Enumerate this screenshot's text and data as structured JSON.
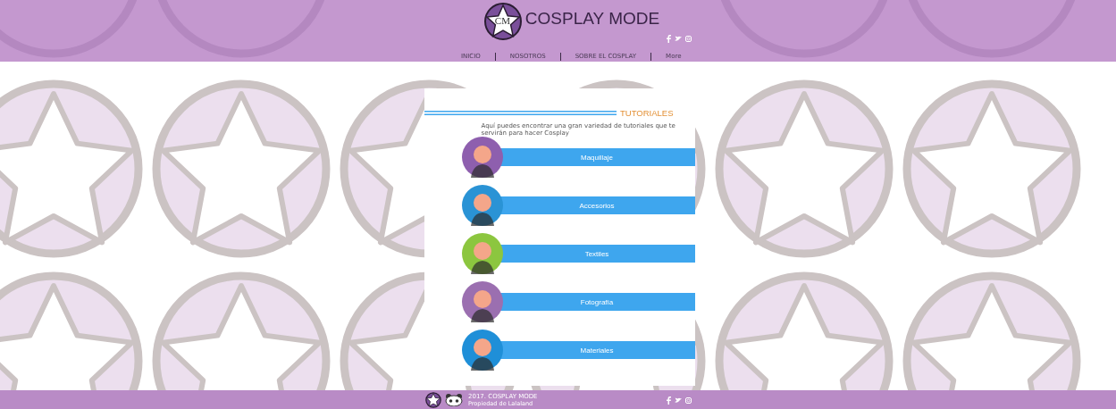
{
  "header": {
    "brand": "COSPLAY MODE",
    "logo_letters": "CM",
    "nav": [
      {
        "label": "INICIO"
      },
      {
        "label": "NOSOTROS"
      },
      {
        "label": "SOBRE EL COSPLAY"
      },
      {
        "label": "More"
      }
    ]
  },
  "section": {
    "title": "TUTORIALES",
    "description": "Aquí puedes encontrar una gran variedad de tutoriales que te servirán para hacer Cosplay",
    "tutorials": [
      {
        "label": "Maquillaje",
        "color": "#8e5fae"
      },
      {
        "label": "Accesorios",
        "color": "#2a93d5"
      },
      {
        "label": "Textiles",
        "color": "#8cc63f"
      },
      {
        "label": "Fotografía",
        "color": "#9b6fb0"
      },
      {
        "label": "Materiales",
        "color": "#1f8fd8"
      }
    ]
  },
  "footer": {
    "line1": "2017. COSPLAY MODE",
    "line2": "Propiedad de Lalaland"
  }
}
